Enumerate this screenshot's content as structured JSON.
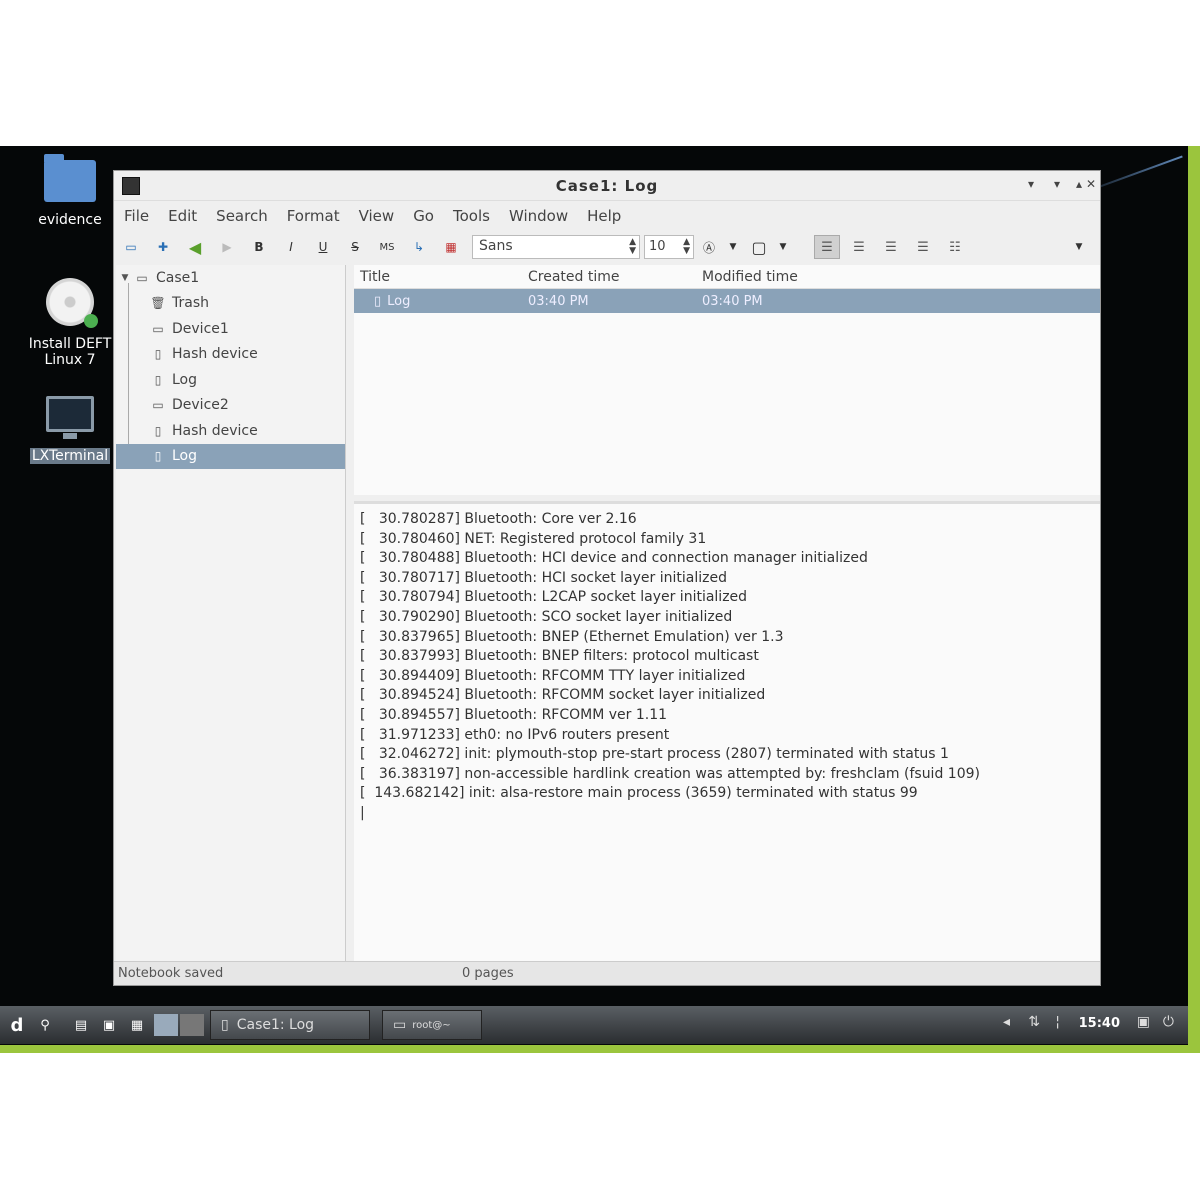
{
  "desktop": {
    "icons": [
      {
        "label": "evidence"
      },
      {
        "label": "Install DEFT Linux 7"
      },
      {
        "label": "LXTerminal"
      }
    ]
  },
  "window": {
    "title": "Case1: Log",
    "menu": [
      "File",
      "Edit",
      "Search",
      "Format",
      "View",
      "Go",
      "Tools",
      "Window",
      "Help"
    ],
    "toolbar": {
      "font_name": "Sans",
      "font_size": "10",
      "strike_label": "S",
      "mono_label": "MS"
    },
    "tree": {
      "items": [
        {
          "label": "Case1",
          "icon": "notebook-icon"
        },
        {
          "label": "Trash",
          "icon": "trash-icon"
        },
        {
          "label": "Device1",
          "icon": "folder-icon"
        },
        {
          "label": "Hash device",
          "icon": "page-icon"
        },
        {
          "label": "Log",
          "icon": "page-icon"
        },
        {
          "label": "Device2",
          "icon": "folder-icon"
        },
        {
          "label": "Hash device",
          "icon": "page-icon"
        },
        {
          "label": "Log",
          "icon": "page-icon"
        }
      ]
    },
    "notelist": {
      "headers": [
        "Title",
        "Created time",
        "Modified time"
      ],
      "rows": [
        {
          "title": "Log",
          "created": "03:40 PM",
          "modified": "03:40 PM"
        }
      ]
    },
    "editor": {
      "lines": [
        "[   30.780287] Bluetooth: Core ver 2.16",
        "[   30.780460] NET: Registered protocol family 31",
        "[   30.780488] Bluetooth: HCI device and connection manager initialized",
        "[   30.780717] Bluetooth: HCI socket layer initialized",
        "[   30.780794] Bluetooth: L2CAP socket layer initialized",
        "[   30.790290] Bluetooth: SCO socket layer initialized",
        "[   30.837965] Bluetooth: BNEP (Ethernet Emulation) ver 1.3",
        "[   30.837993] Bluetooth: BNEP filters: protocol multicast",
        "[   30.894409] Bluetooth: RFCOMM TTY layer initialized",
        "[   30.894524] Bluetooth: RFCOMM socket layer initialized",
        "[   30.894557] Bluetooth: RFCOMM ver 1.11",
        "[   31.971233] eth0: no IPv6 routers present",
        "[   32.046272] init: plymouth-stop pre-start process (2807) terminated with status 1",
        "[   36.383197] non-accessible hardlink creation was attempted by: freshclam (fsuid 109)",
        "[  143.682142] init: alsa-restore main process (3659) terminated with status 99",
        "|"
      ]
    },
    "status": {
      "message": "Notebook saved",
      "pages": "0 pages"
    }
  },
  "taskbar": {
    "tasks": [
      "Case1: Log",
      "root@~"
    ],
    "clock": "15:40"
  },
  "colors": {
    "selection": "#8aa2b8",
    "desktop_bg": "#050708",
    "accent_green": "#9bc53d"
  }
}
